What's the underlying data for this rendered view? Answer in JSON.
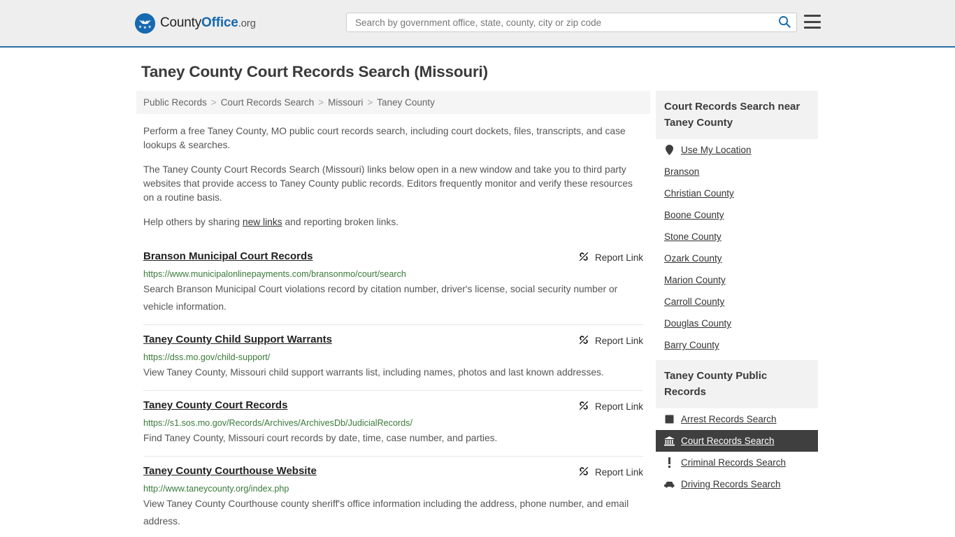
{
  "header": {
    "brand": {
      "part1": "County",
      "part2": "Office",
      "part3": ".org",
      "logo_icon": "eagle-shield-logo"
    },
    "search": {
      "placeholder": "Search by government office, state, county, city or zip code",
      "value": "",
      "search_icon": "search-icon"
    },
    "menu_icon": "hamburger-menu-icon",
    "accent_color": "#2e6da4",
    "background_color": "#eeeeee"
  },
  "page": {
    "title": "Taney County Court Records Search (Missouri)"
  },
  "breadcrumb": {
    "separator": ">",
    "items": [
      {
        "label": "Public Records"
      },
      {
        "label": "Court Records Search"
      },
      {
        "label": "Missouri"
      },
      {
        "label": "Taney County"
      }
    ]
  },
  "intro": {
    "p1": "Perform a free Taney County, MO public court records search, including court dockets, files, transcripts, and case lookups & searches.",
    "p2": "The Taney County Court Records Search (Missouri) links below open in a new window and take you to third party websites that provide access to Taney County public records. Editors frequently monitor and verify these resources on a routine basis.",
    "p3_before": "Help others by sharing ",
    "p3_link": "new links",
    "p3_after": " and reporting broken links."
  },
  "results": {
    "report_label": "Report Link",
    "report_icon": "broken-link-icon",
    "items": [
      {
        "title": "Branson Municipal Court Records",
        "url": "https://www.municipalonlinepayments.com/bransonmo/court/search",
        "description": "Search Branson Municipal Court violations record by citation number, driver's license, social security number or vehicle information."
      },
      {
        "title": " Taney County Child Support Warrants",
        "url": "https://dss.mo.gov/child-support/",
        "description": "View Taney County, Missouri child support warrants list, including names, photos and last known addresses."
      },
      {
        "title": "Taney County Court Records",
        "url": "https://s1.sos.mo.gov/Records/Archives/ArchivesDb/JudicialRecords/",
        "description": "Find Taney County, Missouri court records by date, time, case number, and parties."
      },
      {
        "title": "Taney County Courthouse Website",
        "url": "http://www.taneycounty.org/index.php",
        "description": "View Taney County Courthouse county sheriff's office information including the address, phone number, and email address."
      }
    ]
  },
  "sidebar": {
    "near_panel": {
      "heading": "Court Records Search near Taney County",
      "items": [
        {
          "label": "Use My Location",
          "icon": "map-pin-icon"
        },
        {
          "label": "Branson",
          "icon": ""
        },
        {
          "label": "Christian County",
          "icon": ""
        },
        {
          "label": "Boone County",
          "icon": ""
        },
        {
          "label": "Stone County",
          "icon": ""
        },
        {
          "label": "Ozark County",
          "icon": ""
        },
        {
          "label": "Marion County",
          "icon": ""
        },
        {
          "label": "Carroll County",
          "icon": ""
        },
        {
          "label": "Douglas County",
          "icon": ""
        },
        {
          "label": "Barry County",
          "icon": ""
        }
      ]
    },
    "public_records_panel": {
      "heading": "Taney County Public Records",
      "active_color": "#3f3f3f",
      "items": [
        {
          "label": "Arrest Records Search",
          "icon": "fingerprint-square-icon",
          "active": false
        },
        {
          "label": "Court Records Search",
          "icon": "courthouse-bank-icon",
          "active": true
        },
        {
          "label": "Criminal Records Search",
          "icon": "exclamation-icon",
          "active": false
        },
        {
          "label": "Driving Records Search",
          "icon": "car-icon",
          "active": false
        }
      ]
    }
  }
}
